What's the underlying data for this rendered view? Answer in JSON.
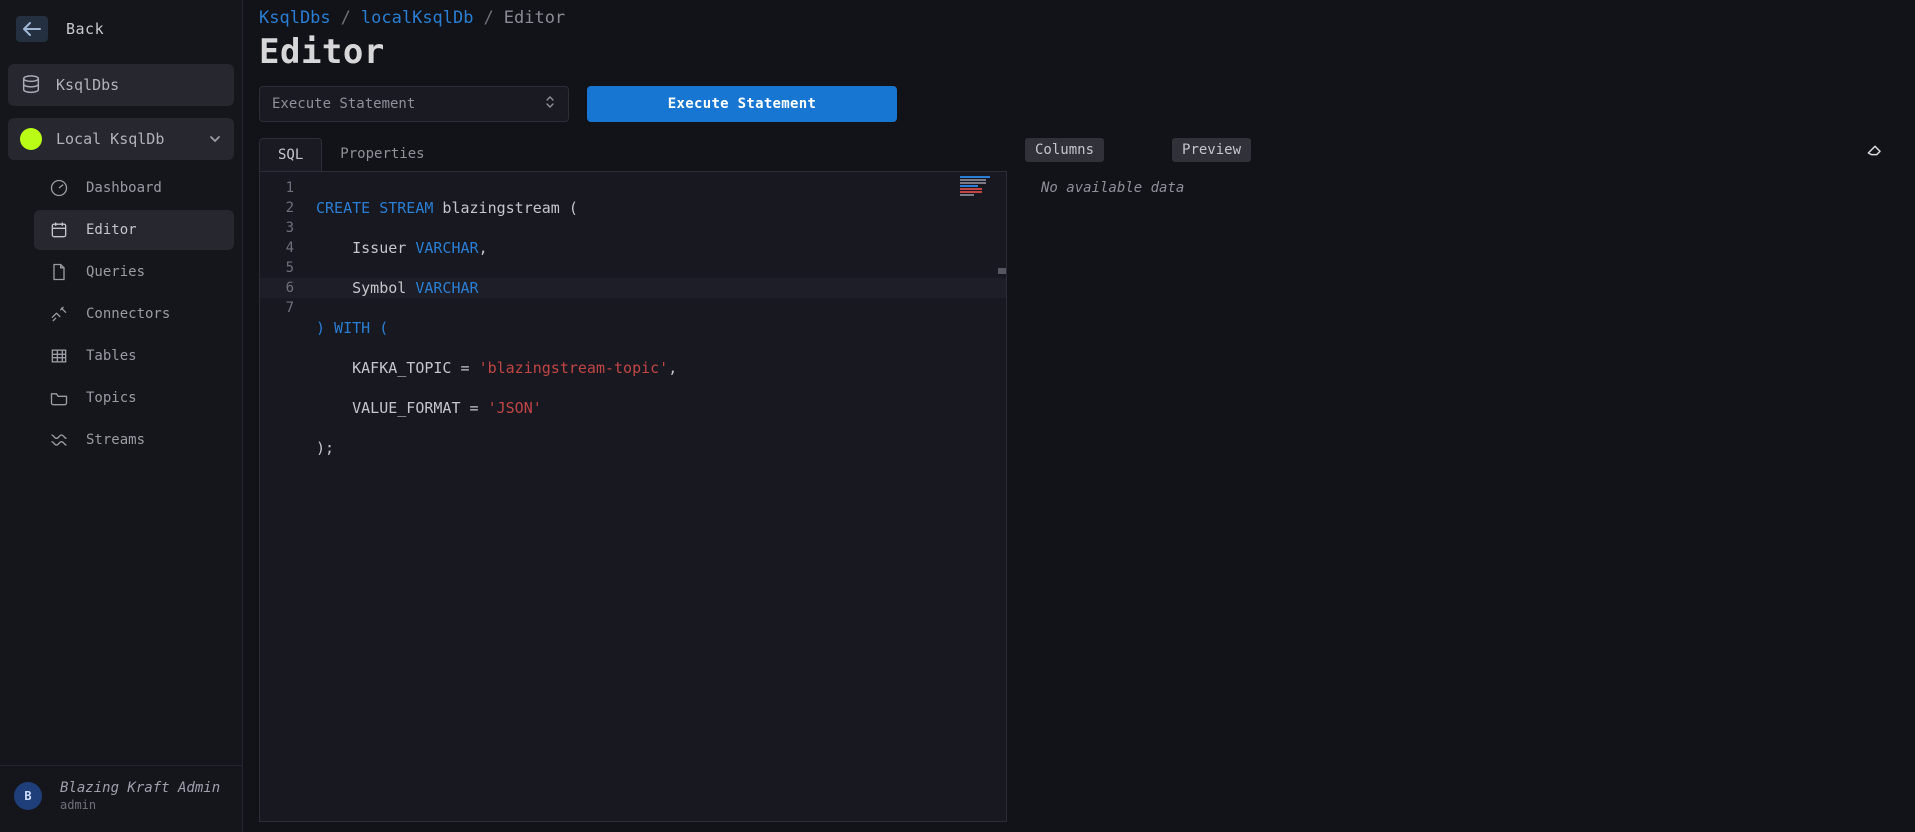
{
  "back": {
    "label": "Back"
  },
  "sidebar": {
    "root_label": "KsqlDbs",
    "cluster_label": "Local KsqlDb",
    "items": [
      {
        "label": "Dashboard"
      },
      {
        "label": "Editor"
      },
      {
        "label": "Queries"
      },
      {
        "label": "Connectors"
      },
      {
        "label": "Tables"
      },
      {
        "label": "Topics"
      },
      {
        "label": "Streams"
      }
    ]
  },
  "footer": {
    "initial": "B",
    "name": "Blazing Kraft Admin",
    "role": "admin"
  },
  "breadcrumbs": {
    "a": "KsqlDbs",
    "b": "localKsqlDb",
    "c": "Editor"
  },
  "title": "Editor",
  "toolbar": {
    "select_label": "Execute Statement",
    "exec_label": "Execute Statement"
  },
  "tabs": {
    "sql": "SQL",
    "props": "Properties"
  },
  "code": {
    "line_count": 7,
    "tokens": {
      "t1_kw": "CREATE",
      "t1_kw2": "STREAM",
      "t1_rest": " blazingstream (",
      "t2_ident": "    Issuer ",
      "t2_type": "VARCHAR",
      "t2_rest": ",",
      "t3_ident": "    Symbol ",
      "t3_type": "VARCHAR",
      "t4_p1": ")",
      "t4_kw": " WITH ",
      "t4_p2": "(",
      "t5_ident": "    KAFKA_TOPIC = ",
      "t5_str": "'blazingstream-topic'",
      "t5_rest": ",",
      "t6_ident": "    VALUE_FORMAT = ",
      "t6_str": "'JSON'",
      "t7": ");"
    },
    "lines_numbers": [
      "1",
      "2",
      "3",
      "4",
      "5",
      "6",
      "7"
    ]
  },
  "right": {
    "columns_label": "Columns",
    "preview_label": "Preview",
    "no_data": "No available data"
  }
}
